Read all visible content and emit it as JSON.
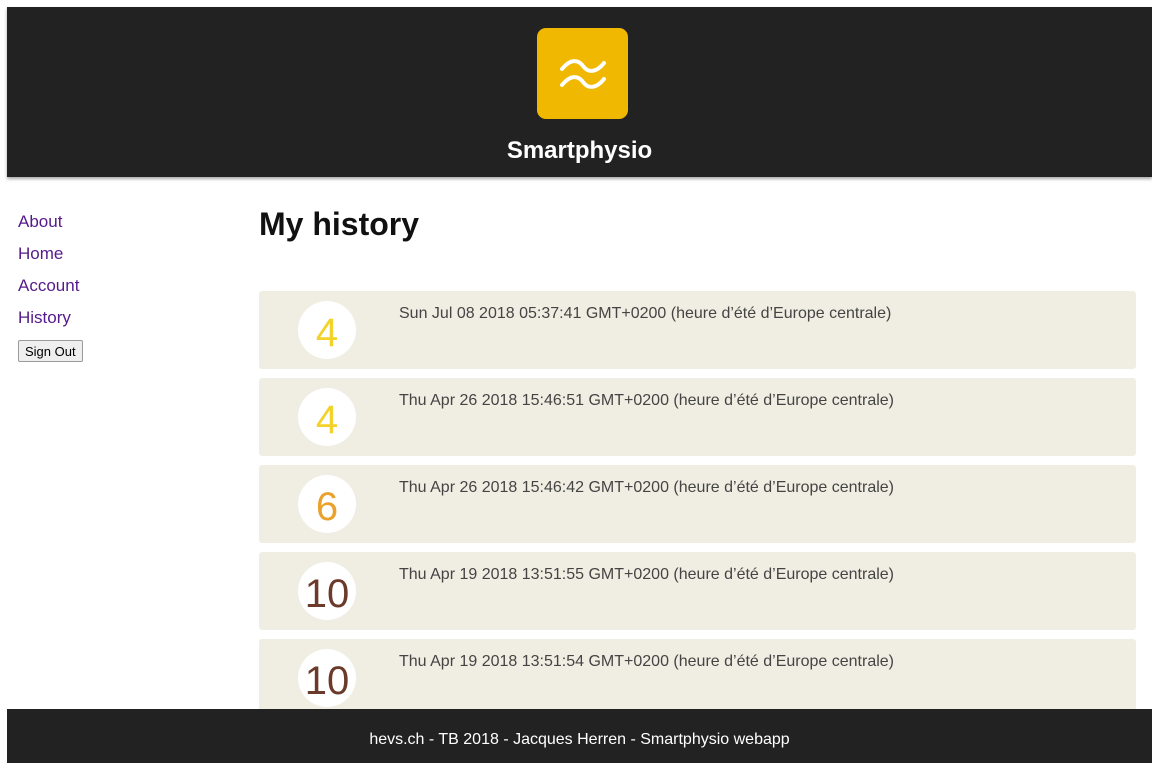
{
  "header": {
    "brand": "Smartphysio",
    "logo_color": "#f0b800"
  },
  "sidebar": {
    "items": [
      {
        "label": "About"
      },
      {
        "label": "Home"
      },
      {
        "label": "Account"
      },
      {
        "label": "History"
      }
    ],
    "signout_label": "Sign Out"
  },
  "main": {
    "title": "My history",
    "entries": [
      {
        "score": "4",
        "score_color": "#f3d22a",
        "date": "Sun Jul 08 2018 05:37:41 GMT+0200 (heure d’été d’Europe centrale)"
      },
      {
        "score": "4",
        "score_color": "#f3d22a",
        "date": "Thu Apr 26 2018 15:46:51 GMT+0200 (heure d’été d’Europe centrale)"
      },
      {
        "score": "6",
        "score_color": "#eaa12e",
        "date": "Thu Apr 26 2018 15:46:42 GMT+0200 (heure d’été d’Europe centrale)"
      },
      {
        "score": "10",
        "score_color": "#6b3a2a",
        "date": "Thu Apr 19 2018 13:51:55 GMT+0200 (heure d’été d’Europe centrale)"
      },
      {
        "score": "10",
        "score_color": "#6b3a2a",
        "date": "Thu Apr 19 2018 13:51:54 GMT+0200 (heure d’été d’Europe centrale)"
      }
    ]
  },
  "footer": {
    "text": "hevs.ch - TB 2018 - Jacques Herren - Smartphysio webapp"
  }
}
